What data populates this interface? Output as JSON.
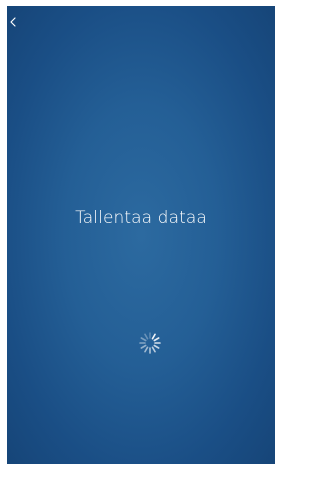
{
  "screen": {
    "background_colors": [
      "#2c6aa0",
      "#164578"
    ],
    "back_icon": "chevron-left-icon",
    "status_text": "Tallentaa dataa",
    "loading_icon": "loading-spinner-icon",
    "text_color": "#ffffff"
  }
}
